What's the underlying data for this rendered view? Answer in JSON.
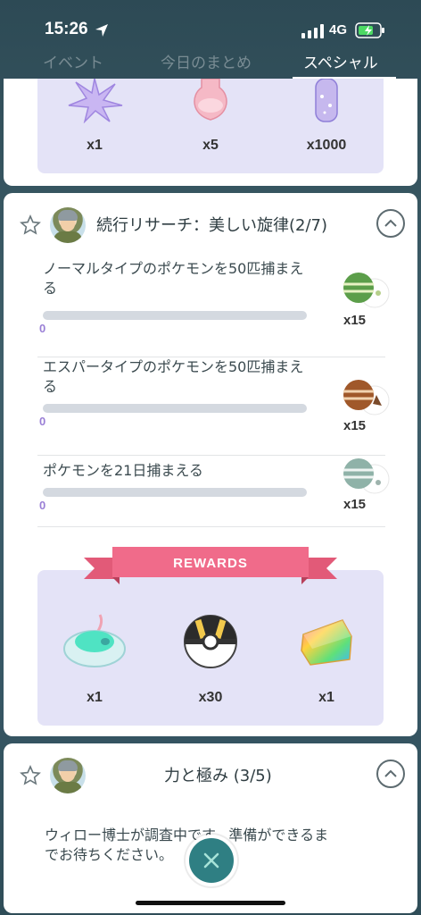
{
  "status_bar": {
    "time": "15:26",
    "network": "4G"
  },
  "tabs": [
    {
      "label": "イベント",
      "active": false
    },
    {
      "label": "今日のまとめ",
      "active": false
    },
    {
      "label": "スペシャル",
      "active": true
    }
  ],
  "top_card": {
    "rewards": [
      {
        "icon": "star-piece-icon",
        "count": "x1"
      },
      {
        "icon": "incense-icon",
        "count": "x5"
      },
      {
        "icon": "stardust-icon",
        "count": "x1000"
      }
    ]
  },
  "research_card": {
    "title": "続行リサーチ：美しい旋律(2/7)",
    "tasks": [
      {
        "text": "ノーマルタイプのポケモンを50匹捕まえる",
        "progress": "0",
        "progress_fraction": 0,
        "reward_icon": "normal-energy-icon",
        "reward_count": "x15"
      },
      {
        "text": "エスパータイプのポケモンを50匹捕まえる",
        "progress": "0",
        "progress_fraction": 0,
        "reward_icon": "psychic-energy-icon",
        "reward_count": "x15"
      },
      {
        "text": "ポケモンを21日捕まえる",
        "progress": "0",
        "progress_fraction": 0,
        "reward_icon": "steel-energy-icon",
        "reward_count": "x15"
      }
    ],
    "rewards_label": "REWARDS",
    "rewards": [
      {
        "icon": "incubator-icon",
        "count": "x1"
      },
      {
        "icon": "ultra-ball-icon",
        "count": "x30"
      },
      {
        "icon": "rare-candy-icon",
        "count": "x1"
      }
    ]
  },
  "bottom_card": {
    "title": "力と極み (3/5)",
    "description": "ウィロー博士が調査中です。準備ができるまでお待ちください。"
  },
  "colors": {
    "accent": "#2f7f83",
    "progress": "#9a7fd6",
    "banner": "#f06b8a"
  }
}
